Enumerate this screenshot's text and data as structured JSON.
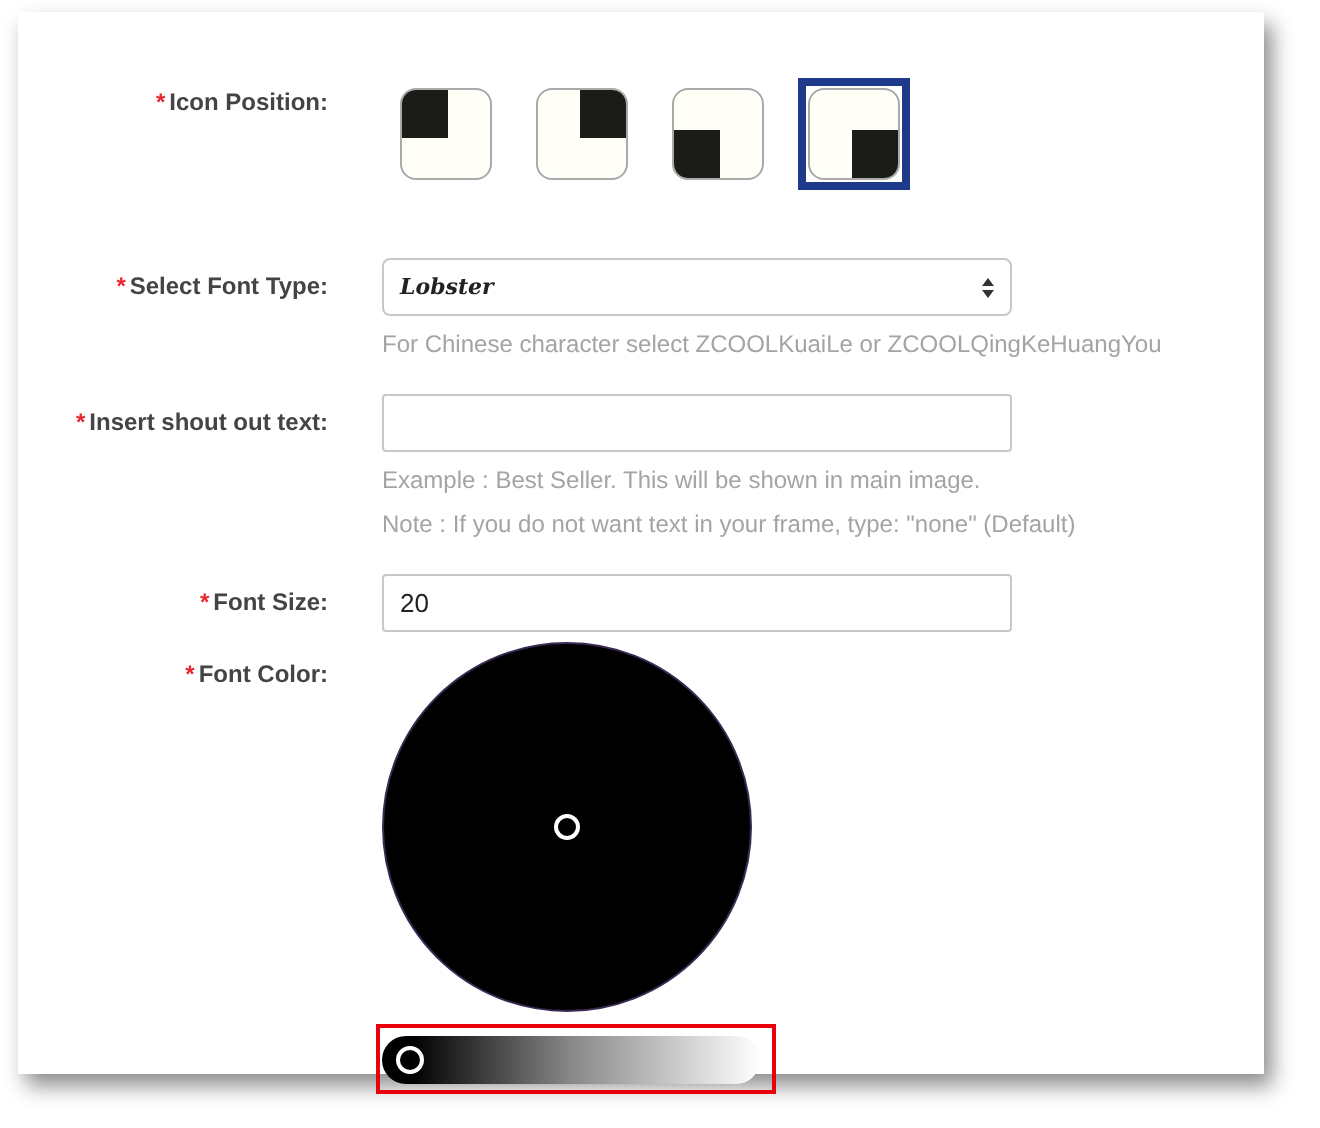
{
  "fields": [
    {
      "kind": "icon_position",
      "required_mark": "*",
      "label": "Icon Position:",
      "options": [
        {
          "kind": "top_left",
          "selected": false
        },
        {
          "kind": "top_right",
          "selected": false
        },
        {
          "kind": "bottom_left",
          "selected": false
        },
        {
          "kind": "bottom_right",
          "selected": true
        }
      ]
    },
    {
      "kind": "select",
      "required_mark": "*",
      "label": "Select Font Type:",
      "value": "Lobster",
      "hints": [
        "For Chinese character select ZCOOLKuaiLe or ZCOOLQingKeHuangYou"
      ]
    },
    {
      "kind": "text",
      "required_mark": "*",
      "label": "Insert shout out text:",
      "hints": [
        "Example : Best Seller. This will be shown in main image.",
        "Note : If you do not want text in your frame, type: \"none\" (Default)"
      ]
    },
    {
      "kind": "text",
      "required_mark": "*",
      "label": "Font Size:",
      "value": "20"
    },
    {
      "kind": "color",
      "required_mark": "*",
      "label": "Font Color:",
      "brightness": {
        "level": 0,
        "highlighted": true
      }
    }
  ]
}
